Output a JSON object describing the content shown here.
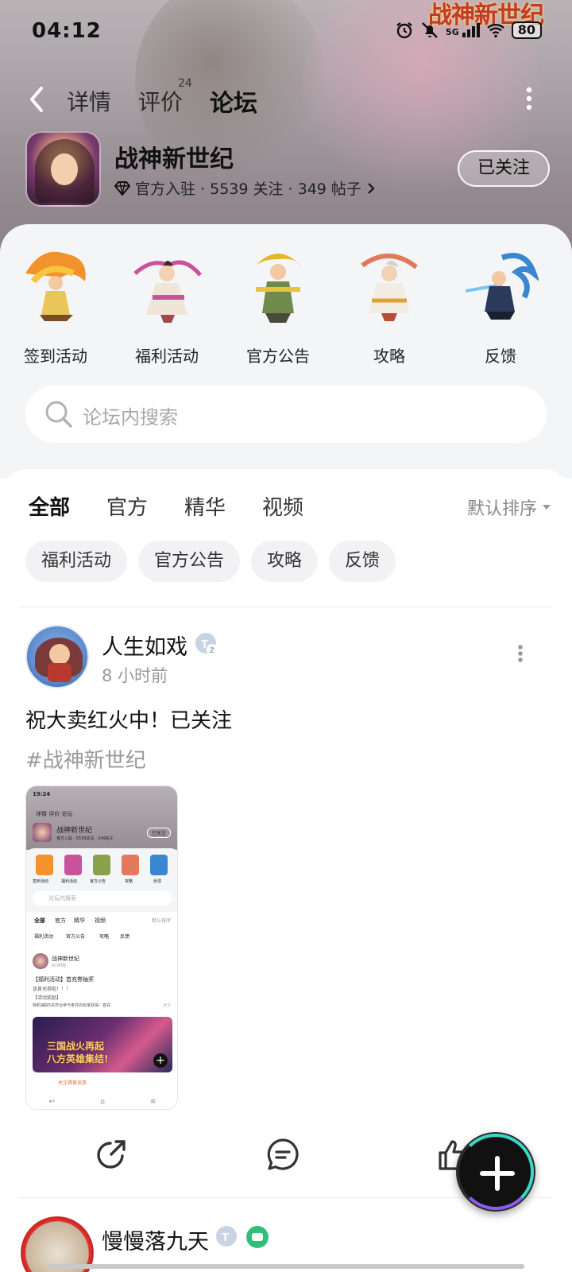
{
  "status": {
    "time": "04:12",
    "network": "5G",
    "battery": "80"
  },
  "banner": {
    "logo_text": "战神新世纪"
  },
  "nav": {
    "tabs": [
      {
        "label": "详情"
      },
      {
        "label": "评价",
        "badge": "24"
      },
      {
        "label": "论坛"
      }
    ],
    "active_tab": "论坛"
  },
  "game": {
    "title": "战神新世纪",
    "meta": "官方入驻 · 5539 关注 · 349 帖子",
    "follow_label": "已关注"
  },
  "categories": [
    {
      "label": "签到活动"
    },
    {
      "label": "福利活动"
    },
    {
      "label": "官方公告"
    },
    {
      "label": "攻略"
    },
    {
      "label": "反馈"
    }
  ],
  "search": {
    "placeholder": "论坛内搜索"
  },
  "filter_tabs": [
    {
      "label": "全部"
    },
    {
      "label": "官方"
    },
    {
      "label": "精华"
    },
    {
      "label": "视频"
    }
  ],
  "sort": {
    "label": "默认排序"
  },
  "chips": [
    {
      "label": "福利活动"
    },
    {
      "label": "官方公告"
    },
    {
      "label": "攻略"
    },
    {
      "label": "反馈"
    }
  ],
  "post": {
    "username": "人生如戏",
    "time": "8 小时前",
    "text": "祝大卖红火中！已关注",
    "tag": "#战神新世纪",
    "screenshot": {
      "time": "19:24",
      "tabs": "详情  评价  论坛",
      "game_title": "战神新世纪",
      "game_meta": "官方入驻 · 5539关注 · 349帖子",
      "follow": "已关注",
      "categories": [
        "签到活动",
        "福利活动",
        "官方公告",
        "攻略",
        "反馈"
      ],
      "search": "论坛内搜索",
      "filter_tabs": [
        "全部",
        "官方",
        "精华",
        "视频"
      ],
      "sort": "默认排序",
      "chips": [
        "福利活动",
        "官方公告",
        "攻略",
        "反馈"
      ],
      "post_user": "战神新世纪",
      "post_time": "8小时前",
      "post_title": "【福利活动】首充券抽奖",
      "post_line1": "送首充券啦！！！",
      "post_line2": "【活动奖励】",
      "post_line3": "随机抽取5名符合参与条件的玩家获得：首充",
      "post_full": "全文",
      "banner_line1": "三国战火再起",
      "banner_line2": "八方英雄集结!",
      "footer": "关注得首充券"
    }
  },
  "post2": {
    "username": "慢慢落九天"
  },
  "icons": {
    "back": "back-arrow-icon",
    "more": "more-vertical-icon",
    "share": "share-icon",
    "comment": "comment-icon",
    "like": "thumbs-up-icon",
    "add": "plus-icon"
  },
  "colors": {
    "accent": "#22c7b4",
    "fab": "#111111"
  }
}
